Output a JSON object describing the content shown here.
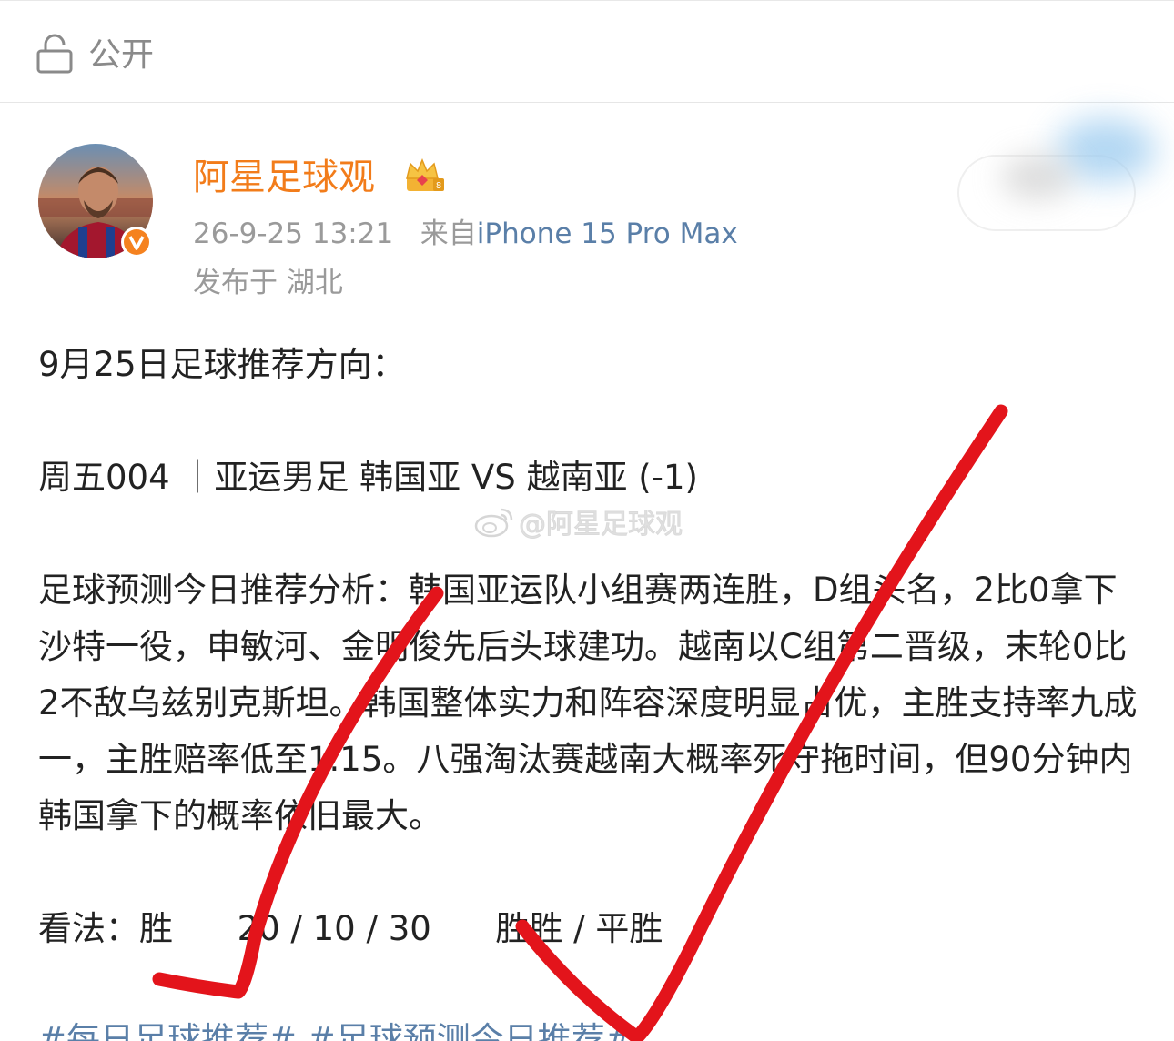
{
  "top_bar": {
    "visibility_icon": "lock-open-icon",
    "visibility_label": "公开"
  },
  "post_header": {
    "avatar_icon": "user-avatar",
    "verified_icon": "verified-v-icon",
    "username": "阿星足球观",
    "badge_icon": "crown-membership-icon",
    "timestamp": "26-9-25 13:21",
    "source_prefix": "来自",
    "device": "iPhone 15 Pro Max",
    "location": "发布于 湖北"
  },
  "post_body": {
    "headline": "9月25日足球推荐方向：",
    "match": "周五004 ｜亚运男足 韩国亚 VS 越南亚 (-1)",
    "analysis": "足球预测今日推荐分析：韩国亚运队小组赛两连胜，D组头名，2比0拿下沙特一役，申敏河、金明俊先后头球建功。越南以C组第二晋级，末轮0比2不敌乌兹别克斯坦。韩国整体实力和阵容深度明显占优，主胜支持率九成一，主胜赔率低至1.15。八强淘汰赛越南大概率死守拖时间，但90分钟内韩国拿下的概率依旧最大。",
    "verdict": "看法：胜      20 / 10 / 30      胜胜 / 平胜",
    "tags": "#每日足球推荐# #足球预测今日推荐#"
  },
  "watermark": {
    "logo_icon": "weibo-logo-icon",
    "text": "@阿星足球观"
  },
  "colors": {
    "username": "#f27c1a",
    "link": "#5a7fa8",
    "meta": "#9a9a9a",
    "checkmark": "#e3141b",
    "verified": "#f5821f"
  }
}
